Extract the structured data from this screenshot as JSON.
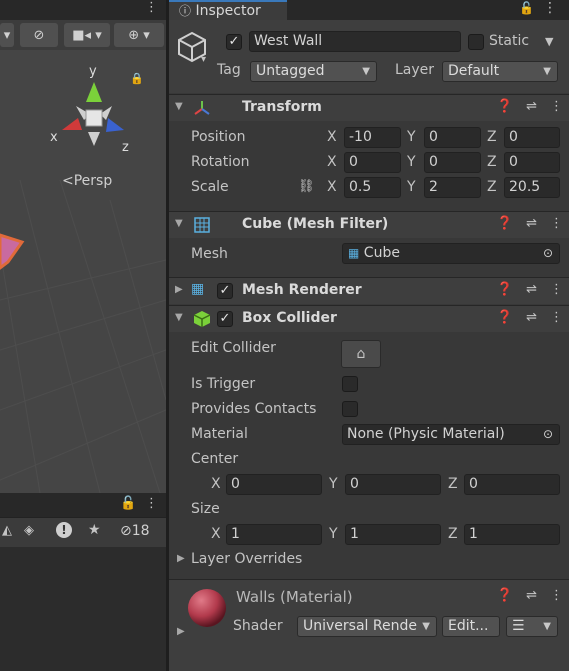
{
  "scene": {
    "gizmo": {
      "y": "y",
      "x": "x",
      "z": "z",
      "persp": "Persp"
    },
    "buttons": [
      {
        "name": "visibility-toggle",
        "glyph": "◉"
      },
      {
        "name": "camera-dropdown",
        "glyph": "▪▾"
      },
      {
        "name": "gizmos-dropdown",
        "glyph": "⊕▾"
      }
    ],
    "hierarchy_count": "18"
  },
  "inspector": {
    "tab": "Inspector",
    "object": {
      "name": "West Wall",
      "active": true,
      "static_label": "Static",
      "tag_label": "Tag",
      "tag_value": "Untagged",
      "layer_label": "Layer",
      "layer_value": "Default"
    },
    "transform": {
      "title": "Transform",
      "position_label": "Position",
      "rotation_label": "Rotation",
      "scale_label": "Scale",
      "x": "X",
      "y": "Y",
      "z": "Z",
      "position": [
        "-10",
        "0",
        "0"
      ],
      "rotation": [
        "0",
        "0",
        "0"
      ],
      "scale": [
        "0.5",
        "2",
        "20.5"
      ]
    },
    "mesh_filter": {
      "title": "Cube (Mesh Filter)",
      "mesh_label": "Mesh",
      "mesh_value": "Cube"
    },
    "mesh_renderer": {
      "title": "Mesh Renderer",
      "enabled": true
    },
    "box_collider": {
      "title": "Box Collider",
      "enabled": true,
      "edit_collider_label": "Edit Collider",
      "is_trigger_label": "Is Trigger",
      "provides_contacts_label": "Provides Contacts",
      "material_label": "Material",
      "material_value": "None (Physic Material)",
      "center_label": "Center",
      "center": [
        "0",
        "0",
        "0"
      ],
      "size_label": "Size",
      "size": [
        "1",
        "1",
        "1"
      ],
      "x": "X",
      "y": "Y",
      "z": "Z",
      "layer_overrides_label": "Layer Overrides"
    },
    "material": {
      "title": "Walls (Material)",
      "shader_label": "Shader",
      "shader_value": "Universal Rende",
      "edit_label": "Edit...",
      "colors": {
        "sphere": "#b23a4c"
      }
    }
  }
}
